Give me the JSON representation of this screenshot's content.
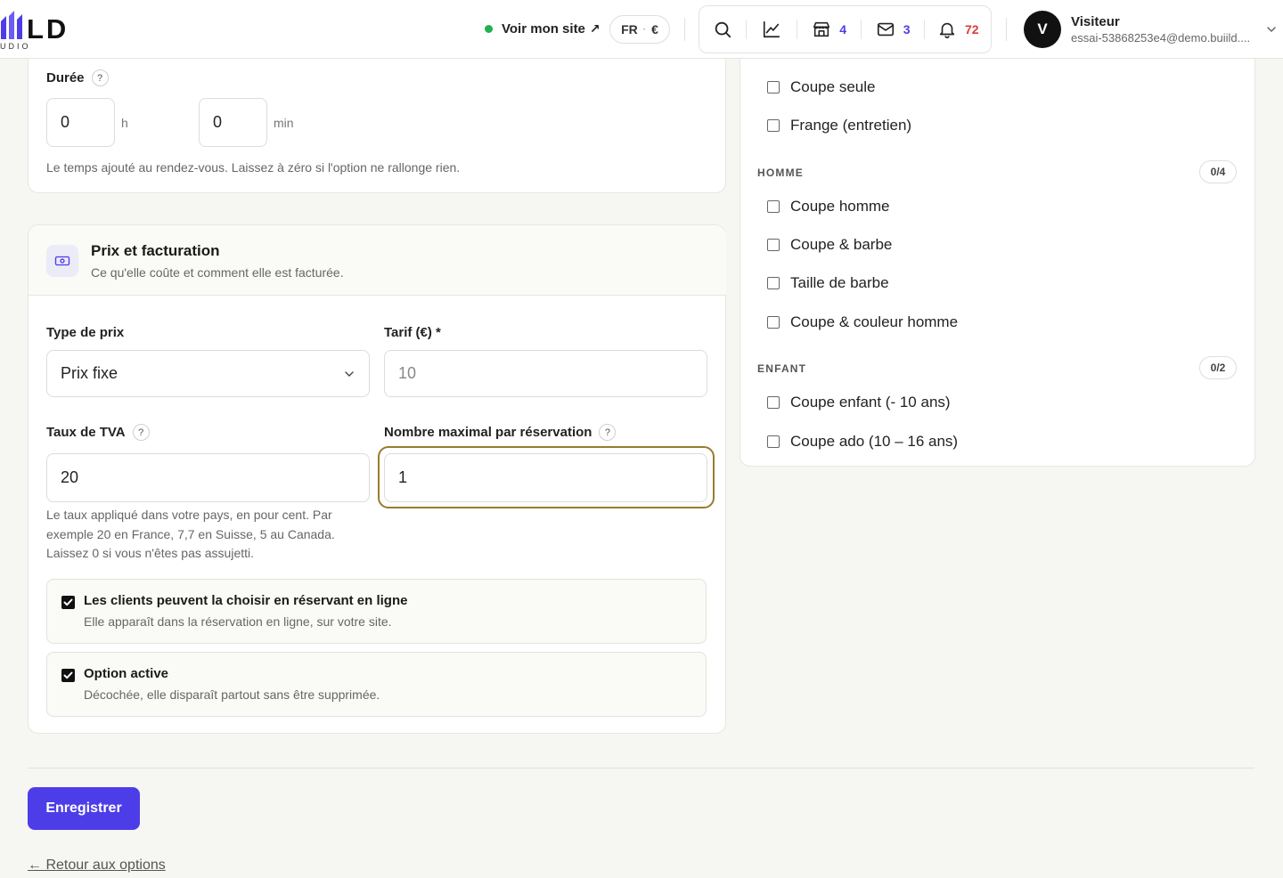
{
  "brand": {
    "logo_text": "LD",
    "logo_sub": "UDIO"
  },
  "header": {
    "site_link": "Voir mon site",
    "site_link_arrow": "↗",
    "lang": "FR",
    "currency": "€",
    "icons": {
      "search": "search-icon",
      "stats": "chart-line-icon",
      "store": "store-icon",
      "mail": "mail-icon",
      "bell": "bell-icon"
    },
    "counts": {
      "store": "4",
      "mail": "3",
      "notifications": "72"
    },
    "user": {
      "initial": "V",
      "name": "Visiteur",
      "email": "essai-53868253e4@demo.buiild...."
    }
  },
  "duration": {
    "label": "Durée",
    "help_icon": "?",
    "hours_value": "0",
    "hours_unit": "h",
    "minutes_value": "0",
    "minutes_unit": "min",
    "help": "Le temps ajouté au rendez-vous. Laissez à zéro si l'option ne rallonge rien."
  },
  "pricing": {
    "title": "Prix et facturation",
    "subtitle": "Ce qu'elle coûte et comment elle est facturée.",
    "price_type_label": "Type de prix",
    "price_type_value": "Prix fixe",
    "rate_label": "Tarif (€) *",
    "rate_value": "10",
    "vat_label": "Taux de TVA",
    "vat_value": "20",
    "vat_help": "Le taux appliqué dans votre pays, en pour cent. Par exemple 20 en France, 7,7 en Suisse, 5 au Canada. Laissez 0 si vous n'êtes pas assujetti.",
    "max_label": "Nombre maximal par réservation",
    "max_value": "1",
    "online_title": "Les clients peuvent la choisir en réservant en ligne",
    "online_sub": "Elle apparaît dans la réservation en ligne, sur votre site.",
    "active_title": "Option active",
    "active_sub": "Décochée, elle disparaît partout sans être supprimée."
  },
  "services": {
    "top_items": [
      "Coupe seule",
      "Frange (entretien)"
    ],
    "groups": [
      {
        "name": "HOMME",
        "count": "0/4",
        "items": [
          "Coupe homme",
          "Coupe & barbe",
          "Taille de barbe",
          "Coupe & couleur homme"
        ]
      },
      {
        "name": "ENFANT",
        "count": "0/2",
        "items": [
          "Coupe enfant (- 10 ans)",
          "Coupe ado (10 – 16 ans)"
        ]
      }
    ]
  },
  "footer": {
    "save_label": "Enregistrer",
    "back_label": "← Retour aux options"
  },
  "colors": {
    "accent": "#4d3de8",
    "focus_ring": "#9a7b2e",
    "online_dot": "#22b14c",
    "alert": "#e03a3a"
  }
}
